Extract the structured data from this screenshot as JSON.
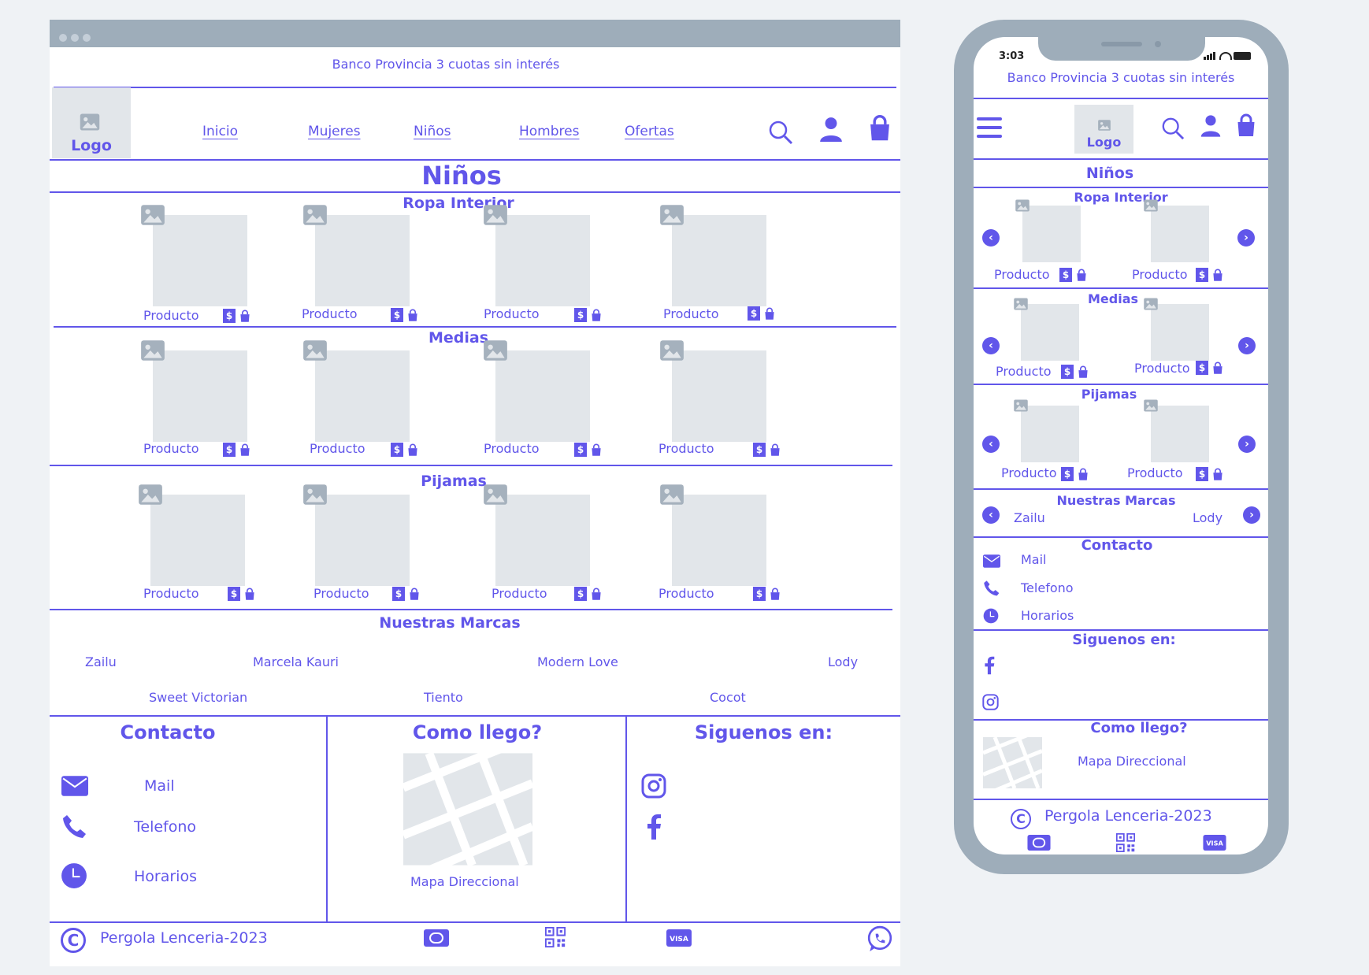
{
  "promo": "Banco Provincia 3 cuotas sin interés",
  "logo": "Logo",
  "nav": [
    "Inicio",
    "Mujeres",
    "Niños",
    "Hombres",
    "Ofertas"
  ],
  "page_title": "Niños",
  "sections": {
    "ropa": "Ropa Interior",
    "medias": "Medias",
    "pijamas": "Pijamas"
  },
  "product_label": "Producto",
  "price_symbol": "$",
  "brands_title": "Nuestras Marcas",
  "brands": [
    "Zailu",
    "Marcela Kauri",
    "Modern Love",
    "Lody",
    "Sweet Victorian",
    "Tiento",
    "Cocot"
  ],
  "contact": {
    "title": "Contacto",
    "items": [
      "Mail",
      "Telefono",
      "Horarios"
    ]
  },
  "how": {
    "title": "Como llego?",
    "map_label": "Mapa Direccional"
  },
  "follow": {
    "title": "Siguenos en:"
  },
  "footer": {
    "copyright_symbol": "C",
    "copyright": "Pergola Lenceria-2023"
  },
  "mobile": {
    "time": "3:03"
  },
  "colors": {
    "accent": "#6156ea",
    "placeholder": "#e2e6ea",
    "frame": "#9eadba",
    "background": "#eff2f5"
  }
}
